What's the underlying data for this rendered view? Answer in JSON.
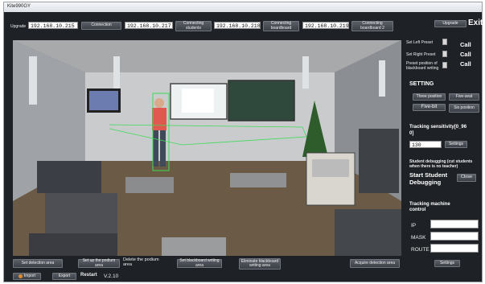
{
  "window": {
    "title": "Kite990GY",
    "exit_label": "Exit"
  },
  "topbar": {
    "upgrade_small_label": "Upgrade",
    "ip_1": "192.168.10.215",
    "connection_label": "Connection",
    "ip_2": "192.168.10.217",
    "connecting_students_label": "Connecting students",
    "ip_3": "192.168.10.218",
    "connecting_boardboard_label": "Connecting boardboard",
    "ip_4": "192.168.10.219",
    "connecting_boardboard2_label": "Connecting boardboard 2",
    "upgrade_label": "Upgrade"
  },
  "right_panel": {
    "left_preset_label": "Set Left Preset",
    "right_preset_label": "Set Right Preset",
    "blackboard_preset_label": "Preset position of blackboard writing",
    "call_1": "Call",
    "call_2": "Call",
    "call_3": "Call",
    "setting_heading": "SETTING",
    "three_position_label": "Three position",
    "five_seat_label": "Five-seat",
    "five_bit_label": "Five-bit",
    "six_position_label": "Six position",
    "sensitivity_heading": "Tracking sensitivity[0_96",
    "sensitivity_heading_2": "0]",
    "sensitivity_value": "130",
    "sensitivity_settings_label": "Settings",
    "debug_note": "Student debugging (cut students when there is no teacher)",
    "start_debugging_label": "Start Student Debugging",
    "close_label": "Close",
    "tracking_control_heading": "Tracking machine control",
    "ip_label": "IP",
    "mask_label": "MASK",
    "route_label": "ROUTE",
    "ip_value": "",
    "mask_value": "",
    "route_value": "",
    "control_settings_label": "Settings"
  },
  "bottom": {
    "set_detection_label": "Set detection area",
    "set_podium_label": "Set up the podium area",
    "delete_podium_label": "Delete the podium area",
    "set_blackboard_label": "Set blackboard writing area",
    "eliminate_blackboard_label": "Eliminate blackboard writing area",
    "acquire_detection_label": "Acquire detection area",
    "import_label": "Import",
    "export_label": "Export",
    "restart_label": "Restart",
    "version": "V.2.10"
  }
}
